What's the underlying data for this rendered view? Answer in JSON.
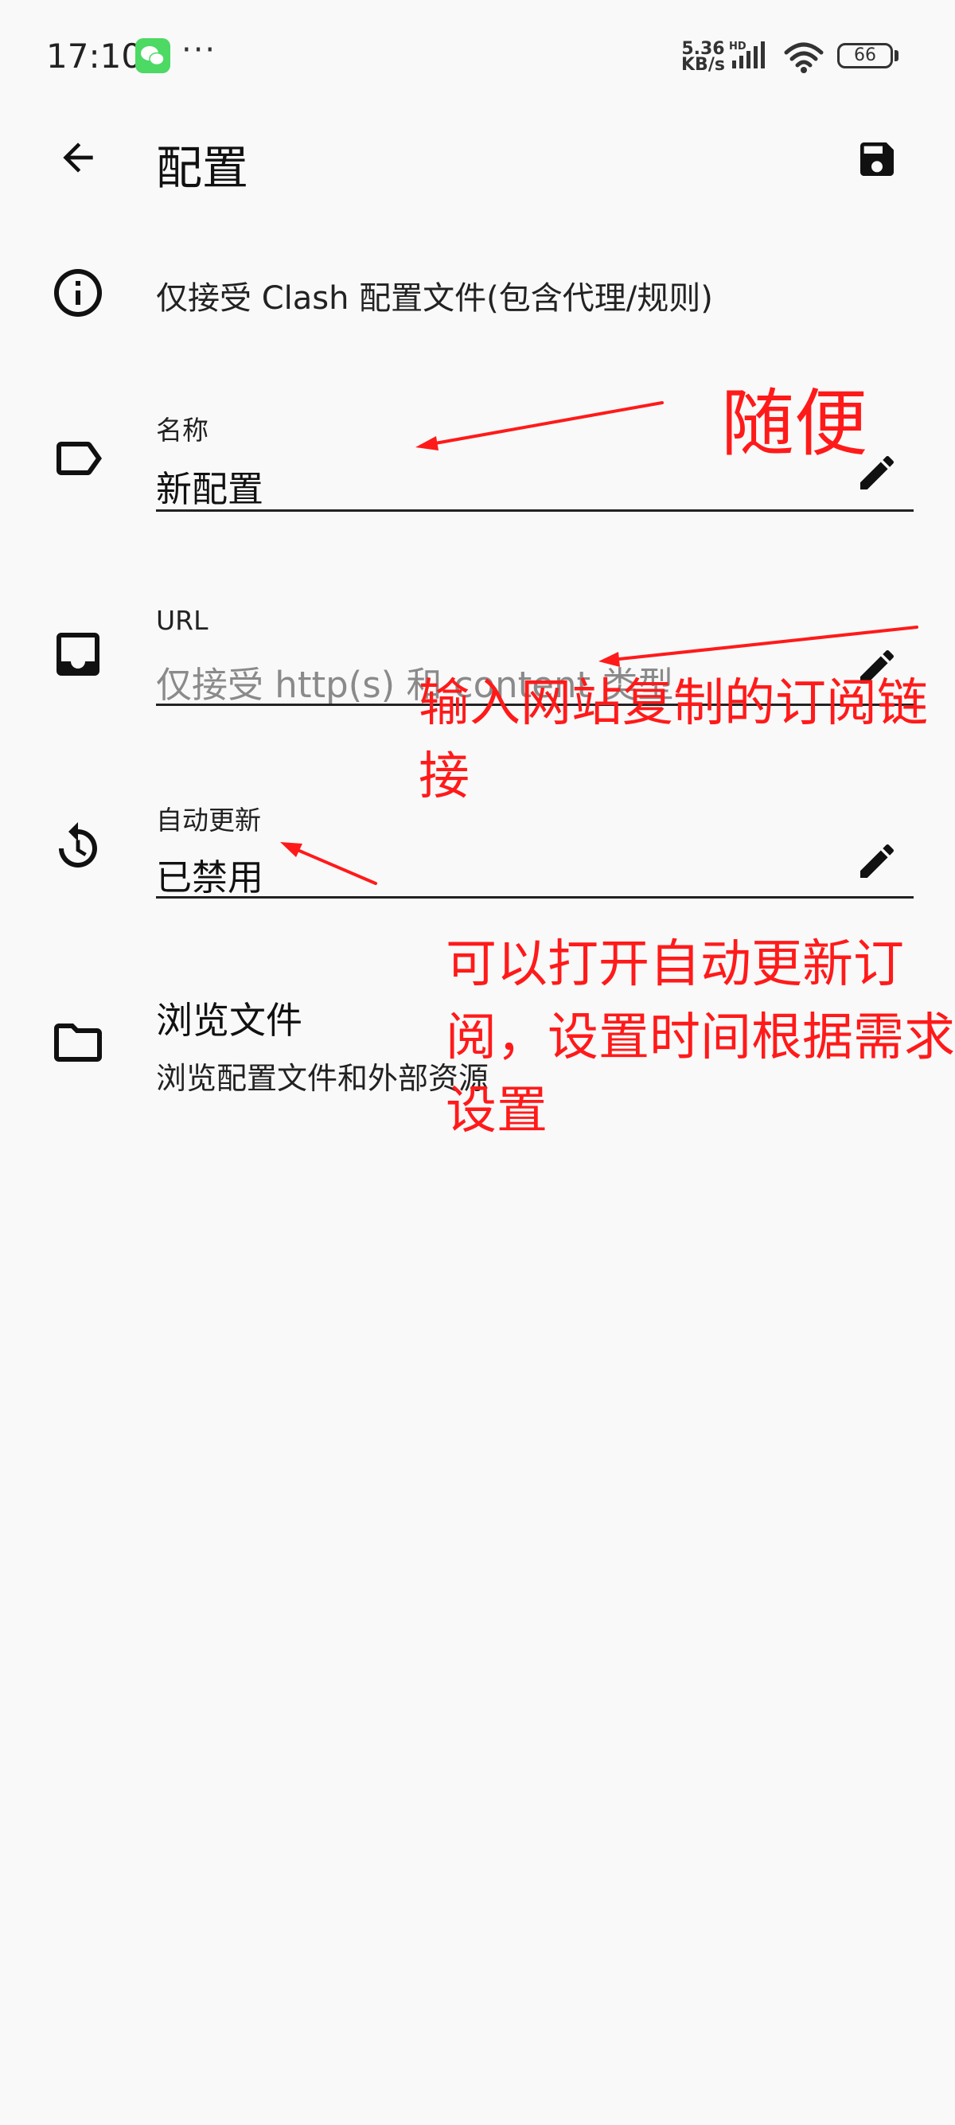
{
  "status_bar": {
    "time": "17:10",
    "more": "···",
    "net_speed_value": "5.36",
    "net_speed_unit": "KB/s",
    "hd_label": "HD",
    "battery": "66"
  },
  "header": {
    "title": "配置",
    "back_icon": "arrow-back-icon",
    "save_icon": "save-icon"
  },
  "info": {
    "text": "仅接受 Clash 配置文件(包含代理/规则)"
  },
  "fields": {
    "name": {
      "label": "名称",
      "value": "新配置"
    },
    "url": {
      "label": "URL",
      "placeholder": "仅接受 http(s) 和 content 类型"
    },
    "auto_update": {
      "label": "自动更新",
      "value": "已禁用"
    }
  },
  "browse": {
    "title": "浏览文件",
    "subtitle": "浏览配置文件和外部资源"
  },
  "annotations": {
    "name_note": "随便",
    "url_note": "输入网站复制的订阅链接",
    "update_note": "可以打开自动更新订阅，设置时间根据需求设置",
    "color": "#ff1a1a"
  }
}
